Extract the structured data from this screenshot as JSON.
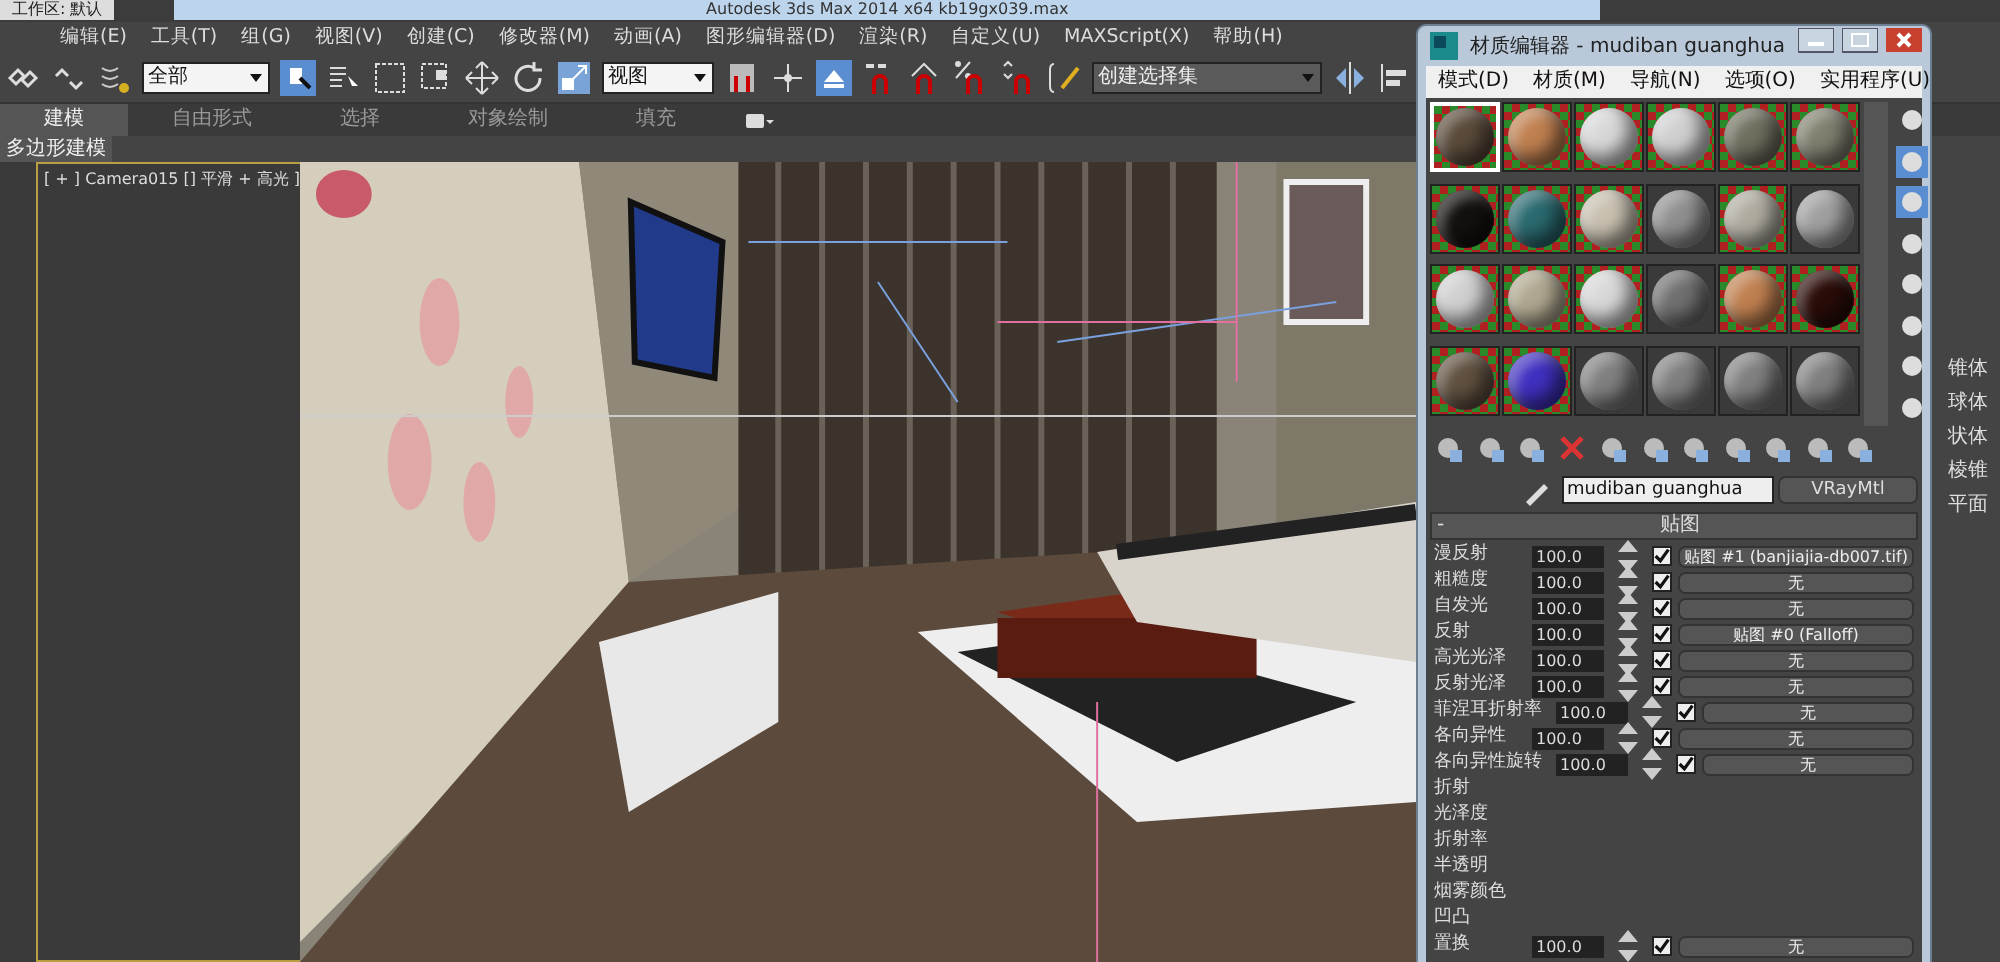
{
  "title_bar": {
    "workspace": "工作区: 默认",
    "title": "Autodesk 3ds Max  2014 x64      kb19gx039.max"
  },
  "menu": [
    "编辑(E)",
    "工具(T)",
    "组(G)",
    "视图(V)",
    "创建(C)",
    "修改器(M)",
    "动画(A)",
    "图形编辑器(D)",
    "渲染(R)",
    "自定义(U)",
    "MAXScript(X)",
    "帮助(H)"
  ],
  "toolbar": {
    "selection_filter": "全部",
    "reference_coord": "视图",
    "named_selection": "创建选择集"
  },
  "ribbon": {
    "tabs": [
      {
        "label": "建模",
        "selected": true
      },
      {
        "label": "自由形式",
        "selected": false
      },
      {
        "label": "选择",
        "selected": false
      },
      {
        "label": "对象绘制",
        "selected": false
      },
      {
        "label": "填充",
        "selected": false
      }
    ],
    "panel_label": "多边形建模"
  },
  "viewport": {
    "label": "[ + ] Camera015 [] 平滑 + 高光 ]"
  },
  "command_panel": {
    "items": [
      "锥体",
      "球体",
      "状体",
      "棱锥",
      "平面"
    ]
  },
  "material_editor": {
    "title": "材质编辑器 - mudiban guanghua",
    "menu": [
      "模式(D)",
      "材质(M)",
      "导航(N)",
      "选项(O)",
      "实用程序(U)"
    ],
    "slots": [
      {
        "color": "#5a4a3a",
        "checker": true,
        "selected": true
      },
      {
        "color": "#c08050",
        "checker": true,
        "selected": false
      },
      {
        "color": "#d8d8d8",
        "checker": true,
        "selected": false
      },
      {
        "color": "#d0d0d0",
        "checker": true,
        "selected": false
      },
      {
        "color": "#707060",
        "checker": true,
        "selected": false
      },
      {
        "color": "#808070",
        "checker": true,
        "selected": false
      },
      {
        "color": "#151010",
        "checker": true,
        "selected": false
      },
      {
        "color": "#2a6a70",
        "checker": true,
        "selected": false
      },
      {
        "color": "#c8c0b0",
        "checker": true,
        "selected": false
      },
      {
        "color": "#909090",
        "checker": false,
        "selected": false
      },
      {
        "color": "#b0aca0",
        "checker": true,
        "selected": false
      },
      {
        "color": "#a0a0a0",
        "checker": false,
        "selected": false
      },
      {
        "color": "#d0d0d0",
        "checker": true,
        "selected": false
      },
      {
        "color": "#b0a890",
        "checker": true,
        "selected": false
      },
      {
        "color": "#d8d8d8",
        "checker": true,
        "selected": false
      },
      {
        "color": "#707070",
        "checker": false,
        "selected": false
      },
      {
        "color": "#c08050",
        "checker": true,
        "selected": false
      },
      {
        "color": "#2a0c08",
        "checker": true,
        "selected": false
      },
      {
        "color": "#605040",
        "checker": true,
        "selected": false
      },
      {
        "color": "#4030c0",
        "checker": true,
        "selected": false
      },
      {
        "color": "#808080",
        "checker": false,
        "selected": false
      },
      {
        "color": "#808080",
        "checker": false,
        "selected": false
      },
      {
        "color": "#808080",
        "checker": false,
        "selected": false
      },
      {
        "color": "#808080",
        "checker": false,
        "selected": false
      }
    ],
    "material_name": "mudiban guanghua",
    "material_type": "VRayMtl",
    "rollout": {
      "collapse": "-",
      "title": "贴图",
      "rows": [
        {
          "label": "漫反射",
          "amount": "100.0",
          "enabled": true,
          "map": "贴图 #1 (banjiajia-db007.tif)"
        },
        {
          "label": "粗糙度",
          "amount": "100.0",
          "enabled": true,
          "map": "无"
        },
        {
          "label": "自发光",
          "amount": "100.0",
          "enabled": true,
          "map": "无"
        },
        {
          "label": "反射",
          "amount": "100.0",
          "enabled": true,
          "map": "贴图 #0 (Falloff)"
        },
        {
          "label": "高光光泽",
          "amount": "100.0",
          "enabled": true,
          "map": "无"
        },
        {
          "label": "反射光泽",
          "amount": "100.0",
          "enabled": true,
          "map": "无"
        },
        {
          "label": "菲涅耳折射率",
          "amount": "100.0",
          "enabled": true,
          "map": "无"
        },
        {
          "label": "各向异性",
          "amount": "100.0",
          "enabled": true,
          "map": "无"
        },
        {
          "label": "各向异性旋转",
          "amount": "100.0",
          "enabled": true,
          "map": "无"
        },
        {
          "label": "折射"
        },
        {
          "label": "光泽度"
        },
        {
          "label": "折射率"
        },
        {
          "label": "半透明"
        },
        {
          "label": "烟雾颜色"
        },
        {
          "label": "凹凸"
        },
        {
          "label": "置换",
          "amount": "100.0",
          "enabled": true,
          "map": "无"
        }
      ]
    }
  }
}
